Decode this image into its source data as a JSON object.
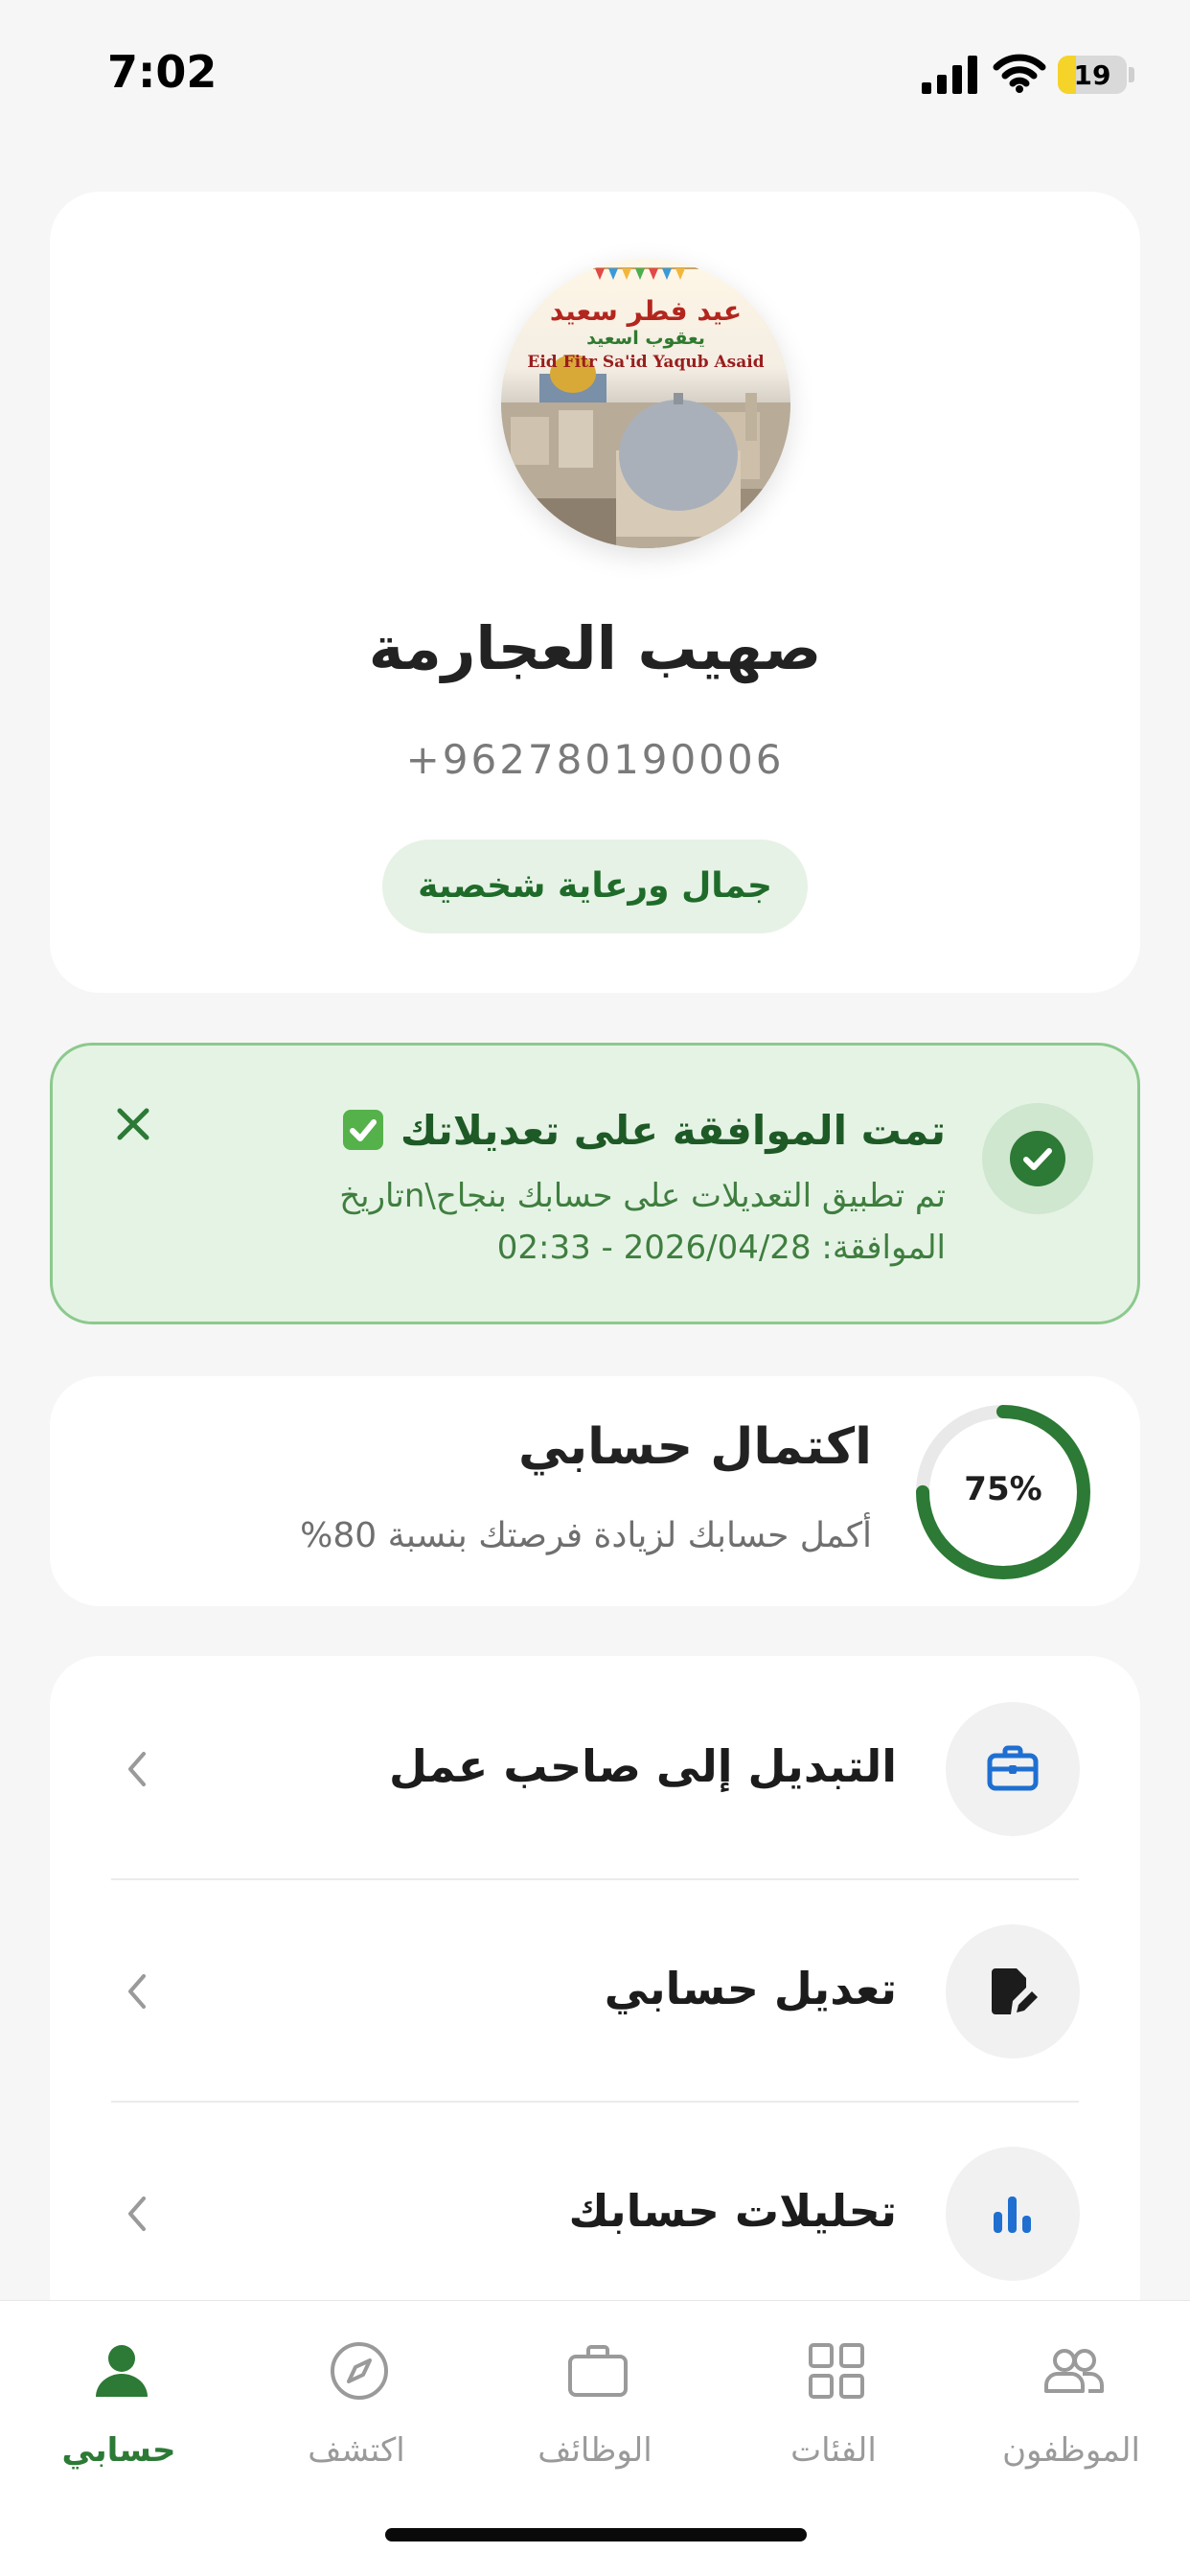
{
  "status_bar": {
    "time": "7:02",
    "battery": "19"
  },
  "profile": {
    "avatar_text": {
      "line1": "عيد فطر سعيد",
      "line2": "يعقوب اسعيد",
      "line3": "Eid Fitr Sa'id Yaqub Asaid"
    },
    "name": "صهيب العجارمة",
    "phone": "+962780190006",
    "category": "جمال ورعاية شخصية"
  },
  "notification": {
    "title": "تمت الموافقة على تعديلاتك",
    "body": "تم تطبيق التعديلات على حسابك بنجاح\\nتاريخ الموافقة: 2026/04/28 - 02:33"
  },
  "completion": {
    "percent_label": "75%",
    "percent_value": 0.75,
    "title": "اكتمال حسابي",
    "subtitle": "أكمل حسابك لزيادة فرصتك بنسبة 80%"
  },
  "menu": {
    "items": [
      {
        "label": "التبديل إلى صاحب عمل",
        "icon": "briefcase-icon"
      },
      {
        "label": "تعديل حسابي",
        "icon": "edit-document-icon"
      },
      {
        "label": "تحليلات حسابك",
        "icon": "bar-chart-icon"
      }
    ]
  },
  "bottom_nav": {
    "items": [
      {
        "label": "الموظفون",
        "icon": "people-icon",
        "active": false
      },
      {
        "label": "الفئات",
        "icon": "grid-icon",
        "active": false
      },
      {
        "label": "الوظائف",
        "icon": "briefcase-icon",
        "active": false
      },
      {
        "label": "اكتشف",
        "icon": "compass-icon",
        "active": false
      },
      {
        "label": "حسابي",
        "icon": "person-icon",
        "active": true
      }
    ]
  },
  "colors": {
    "brand_green": "#2c7a35",
    "notice_bg": "#e5f3e5",
    "notice_border": "#8cc98d",
    "menu_icon_blue": "#1f6fd1"
  }
}
